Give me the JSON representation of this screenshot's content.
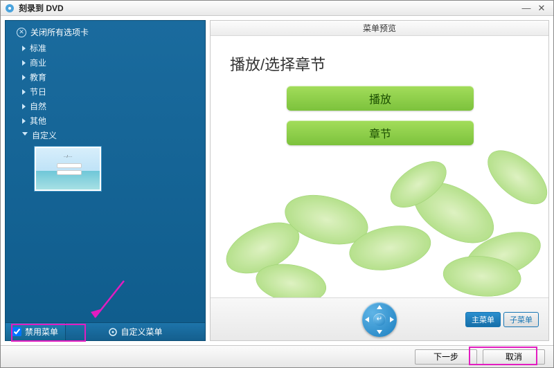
{
  "window": {
    "title": "刻录到 DVD"
  },
  "sidebar": {
    "close_all_tabs": "关闭所有选项卡",
    "categories": [
      {
        "label": "标准"
      },
      {
        "label": "商业"
      },
      {
        "label": "教育"
      },
      {
        "label": "节日"
      },
      {
        "label": "自然"
      },
      {
        "label": "其他"
      },
      {
        "label": "自定义",
        "expanded": true
      }
    ],
    "disable_menu_label": "禁用菜单",
    "disable_menu_checked": true,
    "custom_menu_button": "自定义菜单"
  },
  "preview": {
    "header": "菜单预览",
    "menu_title": "播放/选择章节",
    "play_label": "播放",
    "chapter_label": "章节",
    "main_menu_btn": "主菜单",
    "sub_menu_btn": "子菜单"
  },
  "footer": {
    "next": "下一步",
    "cancel": "取消"
  }
}
